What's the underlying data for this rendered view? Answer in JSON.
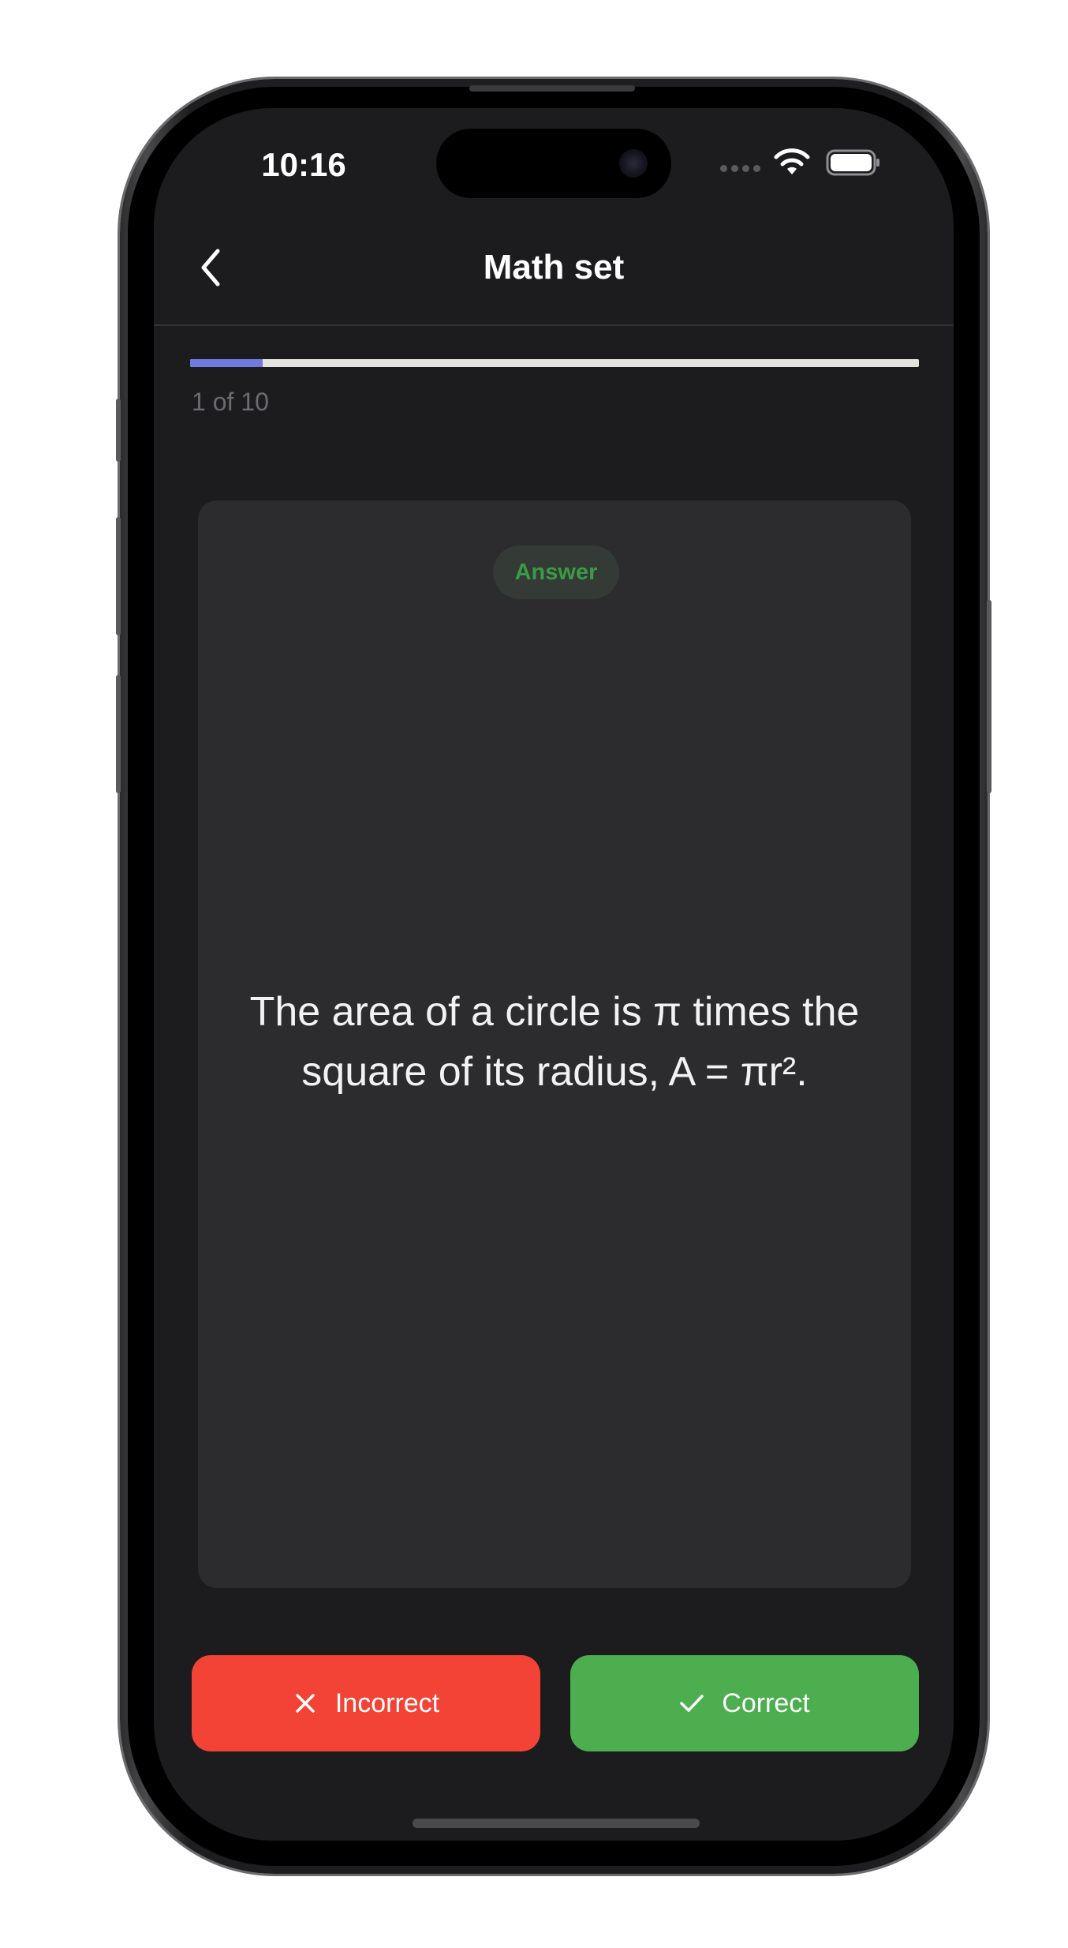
{
  "status_bar": {
    "time": "10:16",
    "icons": [
      "cellular-signal-icon",
      "wifi-icon",
      "battery-icon"
    ]
  },
  "nav": {
    "back_icon": "chevron-left-icon",
    "title": "Math set"
  },
  "progress": {
    "current": 1,
    "total": 10,
    "label": "1 of 10",
    "fill_fraction": 0.1,
    "fill_color": "#7079e0",
    "track_color": "#e3e2dc"
  },
  "card": {
    "side_badge": "Answer",
    "badge_color": "#3a9b45",
    "text": "The area of a circle is π times the square of its radius, A = πr²."
  },
  "actions": {
    "incorrect": {
      "label": "Incorrect",
      "icon": "close-icon",
      "color": "#f34336"
    },
    "correct": {
      "label": "Correct",
      "icon": "checkmark-icon",
      "color": "#4cae4f"
    }
  },
  "colors": {
    "screen_background": "#1c1c1e",
    "card_background": "#2c2c2e"
  }
}
